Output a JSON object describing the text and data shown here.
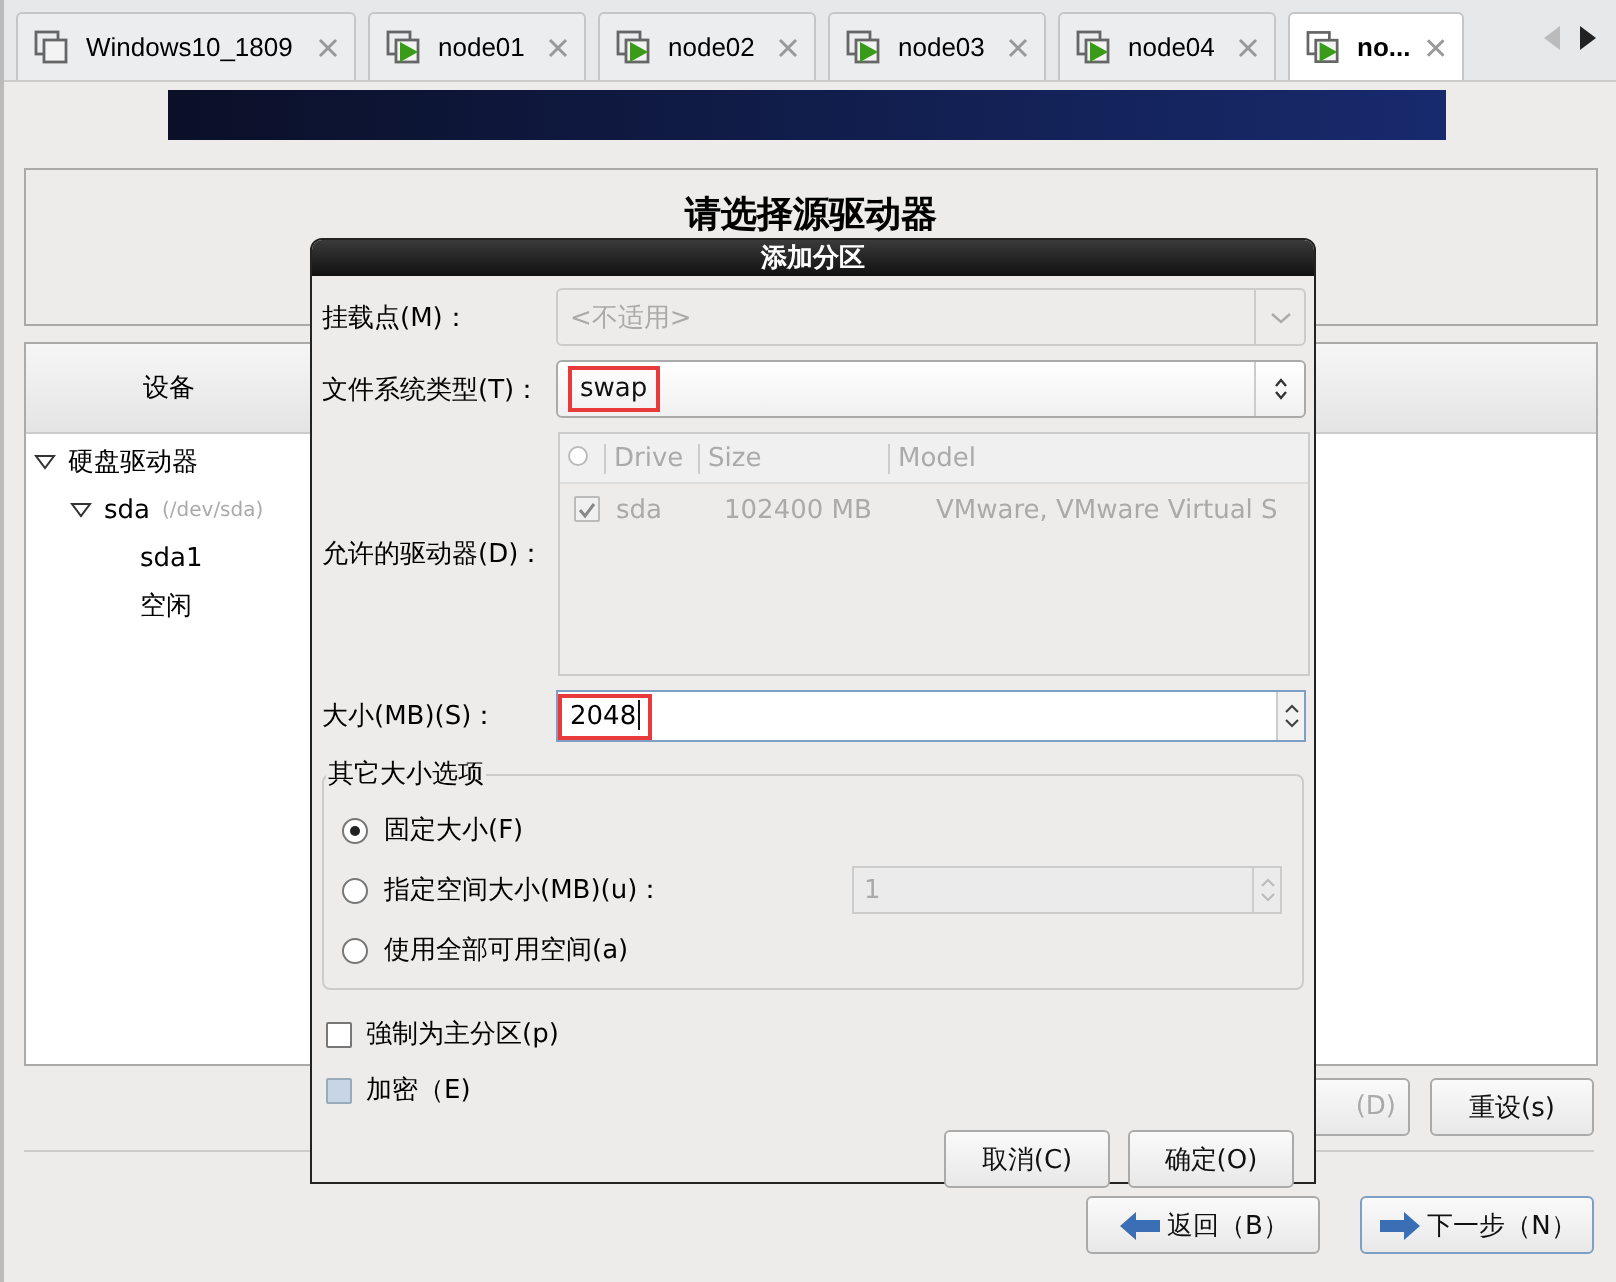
{
  "tabs": [
    {
      "label": "Windows10_1809",
      "kind": "plain",
      "selected": false
    },
    {
      "label": "node01",
      "kind": "running",
      "selected": false
    },
    {
      "label": "node02",
      "kind": "running",
      "selected": false
    },
    {
      "label": "node03",
      "kind": "running",
      "selected": false
    },
    {
      "label": "node04",
      "kind": "running",
      "selected": false
    },
    {
      "label": "no...",
      "kind": "running",
      "selected": true
    }
  ],
  "heading": "请选择源驱动器",
  "devices": {
    "column": "设备",
    "tree": [
      {
        "label": "硬盘驱动器",
        "expanded": true,
        "children": [
          {
            "label": "sda",
            "detail": "(/dev/sda)",
            "expanded": true,
            "children": [
              {
                "label": "sda1"
              },
              {
                "label": "空闲"
              }
            ]
          }
        ]
      }
    ]
  },
  "panel_buttons": [
    "(D)",
    "重设(s)"
  ],
  "nav_buttons": [
    {
      "label": "返回（B）",
      "kind": "back"
    },
    {
      "label": "下一步（N）",
      "kind": "next"
    }
  ],
  "dialog": {
    "title": "添加分区",
    "mount_point": {
      "label": "挂载点(M)：",
      "placeholder": "<不适用>",
      "disabled": true
    },
    "fs_type": {
      "label": "文件系统类型(T)：",
      "value": "swap",
      "highlighted": true
    },
    "drives": {
      "label": "允许的驱动器(D)：",
      "columns": [
        "Drive",
        "Size",
        "Model"
      ],
      "rows": [
        {
          "checked": true,
          "drive": "sda",
          "size": "102400 MB",
          "model": "VMware, VMware Virtual S"
        }
      ]
    },
    "size": {
      "label": "大小(MB)(S)：",
      "value": "2048",
      "highlighted": true
    },
    "options": {
      "title": "其它大小选项",
      "items": [
        {
          "label": "固定大小(F)",
          "selected": true
        },
        {
          "label": "指定空间大小(MB)(u)：",
          "selected": false,
          "value": "1"
        },
        {
          "label": "使用全部可用空间(a)",
          "selected": false
        }
      ]
    },
    "checks": [
      {
        "label": "強制为主分区(p)",
        "checked": false,
        "disabled": false
      },
      {
        "label": "加密（E)",
        "checked": false,
        "disabled": true
      }
    ],
    "buttons": [
      "取消(C)",
      "确定(O)"
    ]
  }
}
